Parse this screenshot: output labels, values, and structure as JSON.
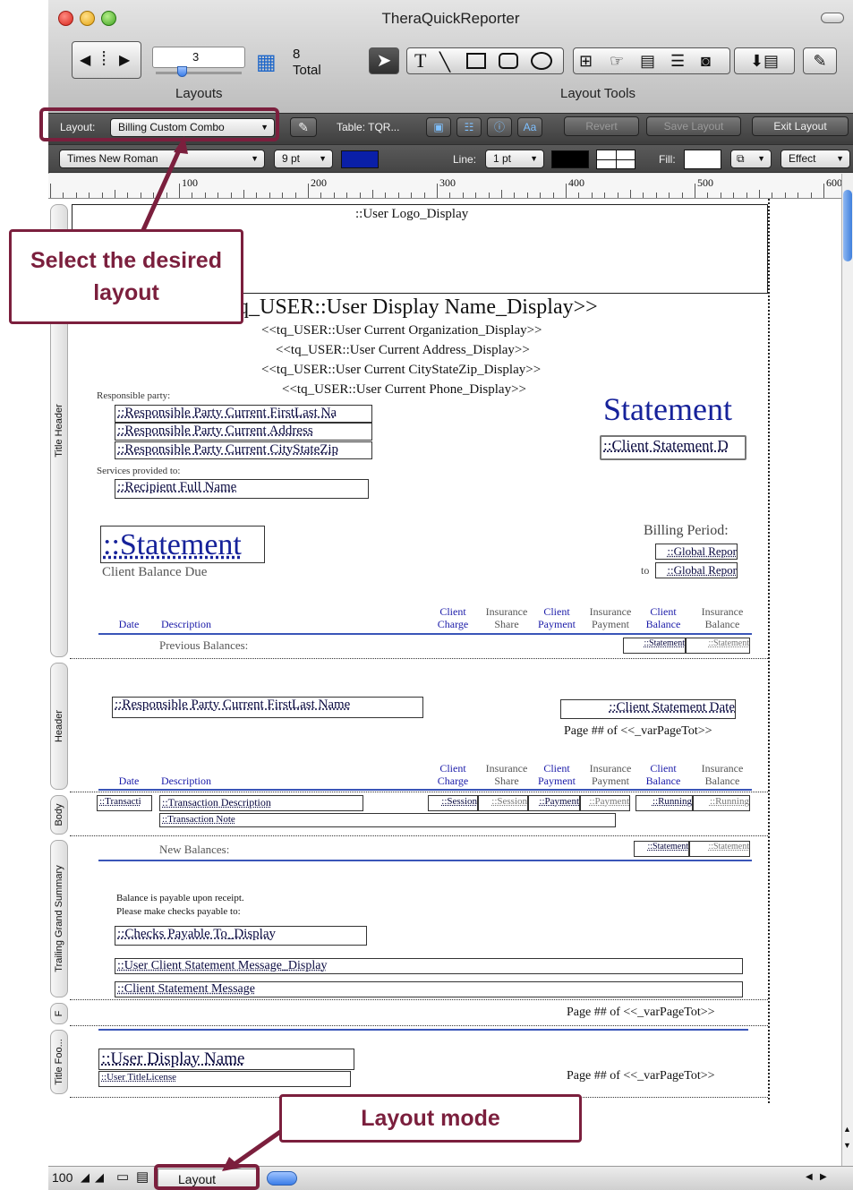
{
  "window": {
    "title": "TheraQuickReporter"
  },
  "toolbar": {
    "layout_number": "3",
    "total_count": "8",
    "total_label": "Total",
    "layouts_label": "Layouts",
    "layout_tools_label": "Layout Tools",
    "text_tool": "T"
  },
  "formatbar": {
    "layout_label": "Layout:",
    "layout_value": "Billing Custom Combo",
    "table_label": "Table: TQR...",
    "revert": "Revert",
    "save_layout": "Save Layout",
    "exit_layout": "Exit Layout",
    "aa": "Aa"
  },
  "fontbar": {
    "font": "Times New Roman",
    "size": "9 pt",
    "line_label": "Line:",
    "line_value": "1 pt",
    "fill_label": "Fill:",
    "effect": "Effect",
    "text_color": "#0a1fa8",
    "line_color": "#000000"
  },
  "ruler": {
    "marks": [
      "100",
      "200",
      "300",
      "400",
      "500",
      "600"
    ]
  },
  "parts": {
    "title_header": "Title Header",
    "header": "Header",
    "body": "Body",
    "trailing_grand_summary": "Trailing Grand Summary",
    "footer": "F",
    "title_footer": "Title Foo..."
  },
  "title_header": {
    "user_logo": "::User Logo_Display",
    "user_display_name": "q_USER::User Display Name_Display>>",
    "org": "<<tq_USER::User Current Organization_Display>>",
    "address": "<<tq_USER::User Current Address_Display>>",
    "citystatezip": "<<tq_USER::User Current CityStateZip_Display>>",
    "phone": "<<tq_USER::User Current Phone_Display>>",
    "responsible_label": "Responsible party:",
    "rp_name": "::Responsible Party Current FirstLast Na",
    "rp_address": "::Responsible Party Current Address",
    "rp_csz": "::Responsible Party Current CityStateZip",
    "services_label": "Services provided to:",
    "recipient": "::Recipient Full Name",
    "statement_title": "Statement",
    "client_statement_d": "::Client Statement D",
    "statement_big": "::Statement",
    "client_balance_due": "Client Balance Due",
    "billing_period": "Billing Period:",
    "global_1": "::Global Repor",
    "to": "to",
    "global_2": "::Global Repor",
    "previous_balances": "Previous Balances:",
    "stmt_1": "::Statement",
    "stmt_2": "::Statement"
  },
  "columns": {
    "date": "Date",
    "description": "Description",
    "client_charge": [
      "Client",
      "Charge"
    ],
    "insurance_share": [
      "Insurance",
      "Share"
    ],
    "client_payment": [
      "Client",
      "Payment"
    ],
    "insurance_payment": [
      "Insurance",
      "Payment"
    ],
    "client_balance": [
      "Client",
      "Balance"
    ],
    "insurance_balance": [
      "Insurance",
      "Balance"
    ]
  },
  "header": {
    "rp_name": "::Responsible Party Current FirstLast Name",
    "client_statement_date": "::Client Statement Date",
    "page": "Page ## of <<_varPageTot>>"
  },
  "body": {
    "transact": "::Transacti",
    "transaction_description": "::Transaction Description",
    "transaction_note": "::Transaction Note",
    "session_1": "::Session",
    "session_2": "::Session",
    "payment_1": "::Payment",
    "payment_2": "::Payment",
    "running_1": "::Running",
    "running_2": "::Running"
  },
  "summary": {
    "new_balances": "New Balances:",
    "stmt_1": "::Statement",
    "stmt_2": "::Statement",
    "payable_line1": "Balance is payable upon receipt.",
    "payable_line2": "Please make checks payable to:",
    "checks_payable": "::Checks Payable To_Display",
    "user_client_msg": "::User Client Statement Message_Display",
    "client_msg": "::Client Statement Message"
  },
  "footer": {
    "page": "Page ## of <<_varPageTot>>"
  },
  "title_footer": {
    "user_display_name": "::User Display Name",
    "user_title": "::User TitleLicense",
    "page": "Page ## of <<_varPageTot>>"
  },
  "status": {
    "zoom": "100",
    "mode": "Layout"
  },
  "callouts": {
    "select_layout": "Select the desired layout",
    "layout_mode": "Layout mode"
  }
}
